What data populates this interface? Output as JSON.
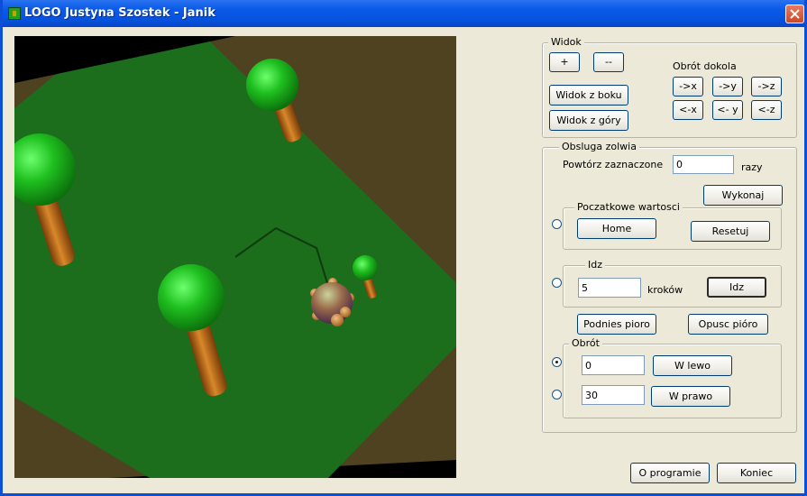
{
  "window": {
    "title": "LOGO Justyna Szostek - Janik"
  },
  "widok": {
    "label": "Widok",
    "zoom_in": "+",
    "zoom_out": "--",
    "side_view": "Widok z boku",
    "top_view": "Widok z góry",
    "rotate_label": "Obrót dokola",
    "rot": {
      "xp": "->x",
      "yp": "->y",
      "zp": "->z",
      "xm": "<-x",
      "ym": "<- y",
      "zm": "<-z"
    }
  },
  "obsluga": {
    "label": "Obsluga zolwia",
    "repeat_label": "Powtórz zaznaczone",
    "repeat_value": "0",
    "repeat_suffix": "razy",
    "execute": "Wykonaj",
    "initial": {
      "label": "Poczatkowe wartosci",
      "home": "Home",
      "reset": "Resetuj"
    },
    "go": {
      "label": "Idz",
      "value": "5",
      "suffix": "kroków",
      "button": "Idz"
    },
    "pen_up": "Podnies pioro",
    "pen_down": "Opusc pióro",
    "rotation": {
      "label": "Obrót",
      "left_value": "0",
      "left_button": "W lewo",
      "right_value": "30",
      "right_button": "W prawo"
    }
  },
  "footer": {
    "about": "O programie",
    "exit": "Koniec"
  },
  "radios": {
    "initial": false,
    "go": false,
    "rotate_left": true,
    "rotate_right": false
  },
  "colors": {
    "ground": "#1c6e1c",
    "border_ground": "#4e4220",
    "trunk": "#b8661a",
    "foliage": "#1fae1f"
  }
}
